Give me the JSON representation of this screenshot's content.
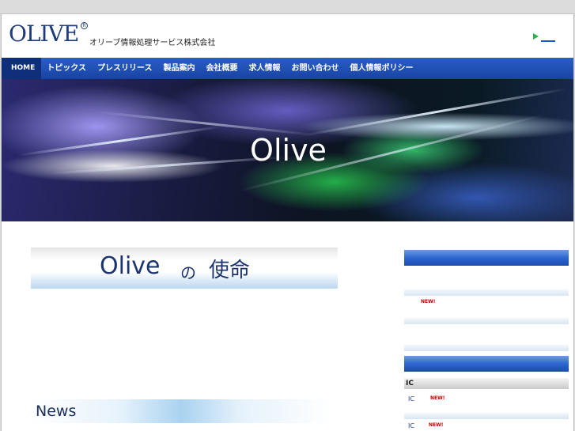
{
  "header": {
    "logo": "OLIVE",
    "logo_mark": "R",
    "company": "オリーブ情報処理サービス株式会社"
  },
  "nav": {
    "items": [
      "HOME",
      "トピックス",
      "プレスリリース",
      "製品案内",
      "会社概要",
      "求人情報",
      "お問い合わせ",
      "個人情報ポリシー"
    ]
  },
  "hero": {
    "title": "Olive"
  },
  "mission": {
    "word": "Olive",
    "particle": "の",
    "text": "使命"
  },
  "news": {
    "label": "News"
  },
  "sidebar": {
    "new_badge": "NEW!",
    "ic_heading": "IC",
    "ic_items": [
      "IC",
      "IC"
    ]
  },
  "colors": {
    "nav_bg": "#1f50b4",
    "nav_active": "#0e2f7a",
    "brand": "#1e3c7a",
    "new_badge": "#c40000",
    "arrow": "#2fb04a"
  }
}
